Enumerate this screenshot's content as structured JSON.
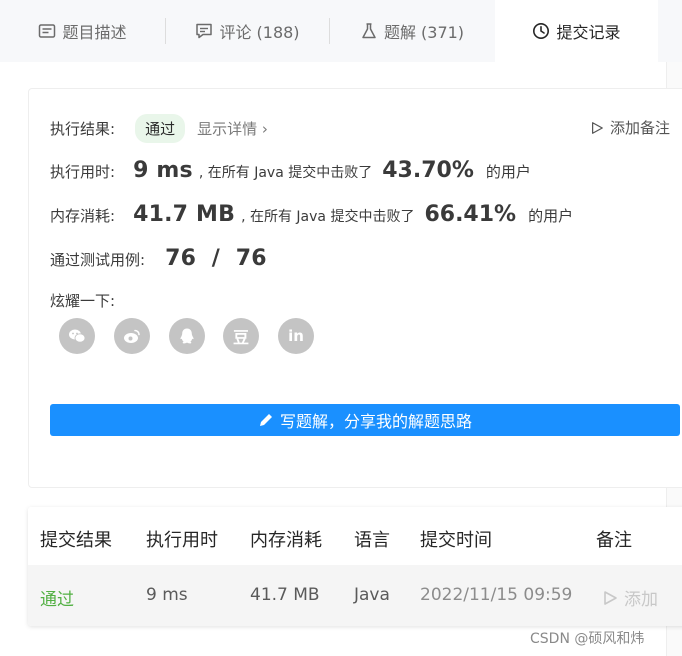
{
  "tabs": [
    {
      "label": "题目描述",
      "icon": "description-icon"
    },
    {
      "label": "评论 (188)",
      "icon": "comment-icon"
    },
    {
      "label": "题解 (371)",
      "icon": "flask-icon"
    },
    {
      "label": "提交记录",
      "icon": "clock-icon",
      "active": true
    }
  ],
  "result": {
    "status_label": "执行结果:",
    "status_value": "通过",
    "details_link": "显示详情 ›",
    "add_note": "添加备注",
    "runtime_label": "执行用时:",
    "runtime_value": "9 ms",
    "runtime_beat_text": ", 在所有 Java 提交中击败了",
    "runtime_percent": "43.70%",
    "runtime_suffix": "的用户",
    "memory_label": "内存消耗:",
    "memory_value": "41.7 MB",
    "memory_beat_text": ", 在所有 Java 提交中击败了",
    "memory_percent": "66.41%",
    "memory_suffix": "的用户",
    "tests_label": "通过测试用例:",
    "tests_value": "76  /  76",
    "share_label": "炫耀一下:",
    "share_icons": [
      "wechat-icon",
      "weibo-icon",
      "qq-icon",
      "douban-icon",
      "linkedin-icon"
    ],
    "douban_glyph": "豆",
    "linkedin_glyph": "in",
    "solution_button": "写题解，分享我的解题思路"
  },
  "table": {
    "headers": [
      "提交结果",
      "执行用时",
      "内存消耗",
      "语言",
      "提交时间",
      "备注"
    ],
    "rows": [
      {
        "status": "通过",
        "runtime": "9 ms",
        "memory": "41.7 MB",
        "language": "Java",
        "time": "2022/11/15 09:59",
        "note": "添加"
      }
    ]
  },
  "watermark": "CSDN @硕风和炜",
  "colors": {
    "accent": "#1a90ff",
    "pass_green": "#52b043",
    "pass_badge_bg": "#e9f6ea"
  }
}
